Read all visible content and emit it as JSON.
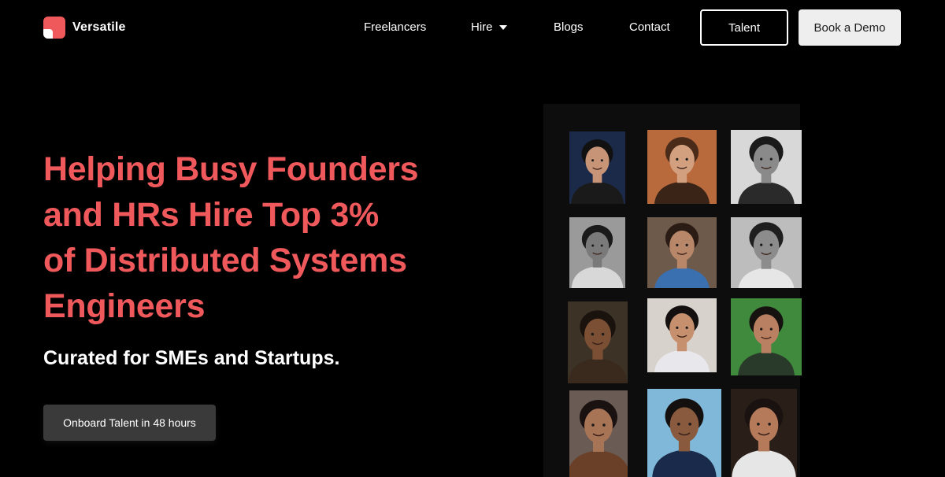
{
  "brand": {
    "name": "Versatile",
    "accent_color": "#f0595c"
  },
  "nav": {
    "links": [
      {
        "label": "Freelancers"
      },
      {
        "label": "Hire",
        "has_dropdown": true
      },
      {
        "label": "Blogs"
      },
      {
        "label": "Contact"
      }
    ],
    "talent_button": "Talent",
    "demo_button": "Book a Demo"
  },
  "hero": {
    "title_lines": [
      "Helping Busy Founders",
      "and HRs Hire Top 3%",
      "of Distributed Systems",
      "Engineers"
    ],
    "subtitle": "Curated for SMEs and Startups.",
    "cta_button": "Onboard Talent in 48 hours"
  },
  "talent_grid": {
    "photos": [
      {
        "bg": "#1c2a4a",
        "skin": "#c89478",
        "hair": "#111111",
        "shirt": "#1a1a1a"
      },
      {
        "bg": "#b86a3c",
        "skin": "#d3a07f",
        "hair": "#4a2a18",
        "shirt": "#3a2418"
      },
      {
        "bg": "#d8d8d8",
        "skin": "#8a8a8a",
        "hair": "#1a1a1a",
        "shirt": "#2a2a2a"
      },
      {
        "bg": "#9a9a9a",
        "skin": "#7a7a7a",
        "hair": "#1a1a1a",
        "shirt": "#d8d8d8"
      },
      {
        "bg": "#6e5a4a",
        "skin": "#b8876a",
        "hair": "#2a1c14",
        "shirt": "#3a6fb0"
      },
      {
        "bg": "#bdbdbd",
        "skin": "#8c8c8c",
        "hair": "#1f1f1f",
        "shirt": "#e6e6e6"
      },
      {
        "bg": "#3c3226",
        "skin": "#7a4f34",
        "hair": "#1a120c",
        "shirt": "#3a2a1e"
      },
      {
        "bg": "#d8d2cc",
        "skin": "#c6906e",
        "hair": "#141010",
        "shirt": "#e8e8ec"
      },
      {
        "bg": "#3f8a3c",
        "skin": "#b98062",
        "hair": "#161210",
        "shirt": "#2a3a2a"
      },
      {
        "bg": "#6a5c54",
        "skin": "#a87456",
        "hair": "#1a1210",
        "shirt": "#6a4028"
      },
      {
        "bg": "#7fb8d8",
        "skin": "#8a5a3e",
        "hair": "#141010",
        "shirt": "#1a2a4a"
      },
      {
        "bg": "#2a1e18",
        "skin": "#b47a5a",
        "hair": "#1a1210",
        "shirt": "#e6e6e6"
      }
    ]
  }
}
